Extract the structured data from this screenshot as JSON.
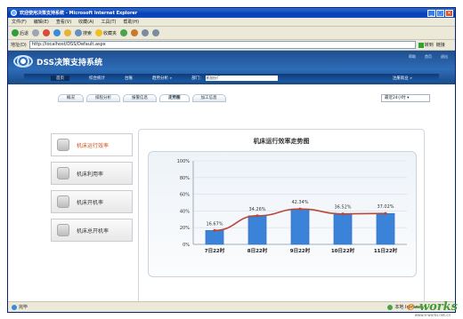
{
  "window": {
    "title": "欢迎使用决策支持系统 - Microsoft Internet Explorer"
  },
  "menu": [
    "文件(F)",
    "编辑(E)",
    "查看(V)",
    "收藏(A)",
    "工具(T)",
    "帮助(H)"
  ],
  "toolbar": {
    "back": "后退",
    "search": "搜索",
    "favorites": "收藏夹"
  },
  "address": {
    "label": "地址(D)",
    "url": "http://localhost/DSS/Default.aspx",
    "go": "转到",
    "links": "链接"
  },
  "header": {
    "logo_text": "DSS决策支持系统",
    "links": [
      "帮助",
      "首页",
      "退出"
    ]
  },
  "nav": {
    "items": [
      "首页",
      "综合统计",
      "台账",
      "趋势分析 »"
    ],
    "dept_label": "部门：",
    "dept_value": "机加分厂",
    "exit": "注册就业 »"
  },
  "tabs": [
    "概况",
    "排程分析",
    "报警信息",
    "走势图",
    "加工信息"
  ],
  "active_tab": 3,
  "range": {
    "value": "最近24小时"
  },
  "side": [
    "机床运行效率",
    "机床利用率",
    "机床开机率",
    "机床总开机率"
  ],
  "active_side": 0,
  "chart_data": {
    "type": "bar",
    "title": "机床运行效率走势图",
    "categories": [
      "7日22时",
      "8日22时",
      "9日22时",
      "10日22时",
      "11日22时"
    ],
    "values": [
      16.67,
      34.26,
      42.34,
      36.52,
      37.02
    ],
    "data_labels": [
      "16.67%",
      "34.26%",
      "42.34%",
      "36.52%",
      "37.02%"
    ],
    "y_ticks": [
      "0%",
      "20%",
      "40%",
      "60%",
      "80%",
      "100%"
    ],
    "ylim": [
      0,
      100
    ],
    "overlay": "line",
    "colors": {
      "bar": "#3b82d9",
      "line": "#b8483a"
    }
  },
  "status": {
    "left": "完毕",
    "right": "本地 Intranet"
  },
  "watermark": {
    "main": "e-works",
    "sub": "www.e-works.net.cn"
  }
}
